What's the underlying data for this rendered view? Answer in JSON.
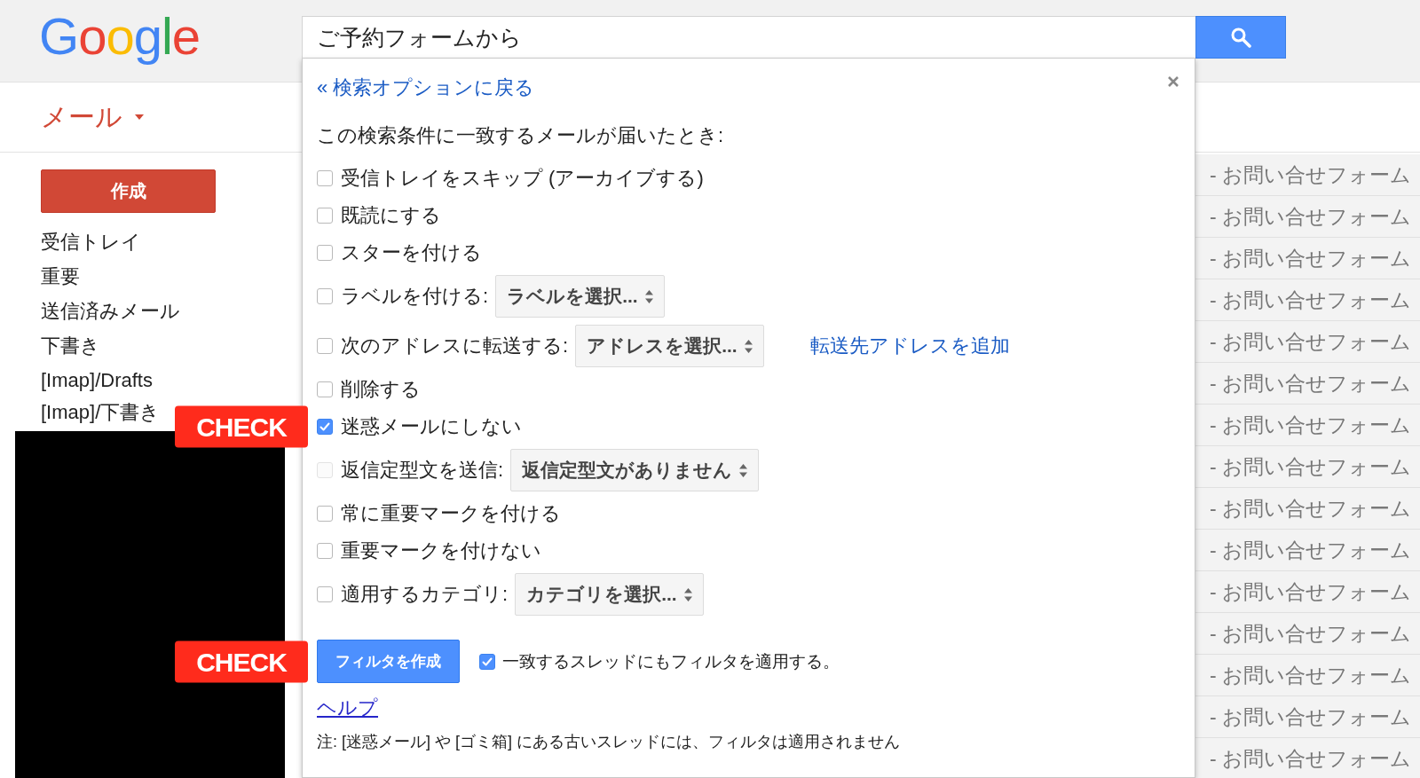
{
  "header": {
    "logo": "Google",
    "search": {
      "value": "ご予約フォームから"
    }
  },
  "app_menu": {
    "label": "メール"
  },
  "sidebar": {
    "compose_button": "作成",
    "items": [
      "受信トレイ",
      "重要",
      "送信済みメール",
      "下書き",
      "[Imap]/Drafts",
      "[Imap]/下書き"
    ]
  },
  "filter_dialog": {
    "back_link": "« 検索オプションに戻る",
    "heading": "この検索条件に一致するメールが届いたとき:",
    "options": [
      {
        "kind": "checkbox",
        "label": "受信トレイをスキップ (アーカイブする)",
        "checked": false,
        "disabled": false
      },
      {
        "kind": "checkbox",
        "label": "既読にする",
        "checked": false,
        "disabled": false
      },
      {
        "kind": "checkbox",
        "label": "スターを付ける",
        "checked": false,
        "disabled": false
      },
      {
        "kind": "select",
        "label": "ラベルを付ける:",
        "checked": false,
        "disabled": false,
        "select": "ラベルを選択..."
      },
      {
        "kind": "select",
        "label": "次のアドレスに転送する:",
        "checked": false,
        "disabled": false,
        "select": "アドレスを選択...",
        "link": "転送先アドレスを追加"
      },
      {
        "kind": "checkbox",
        "label": "削除する",
        "checked": false,
        "disabled": false
      },
      {
        "kind": "checkbox",
        "label": "迷惑メールにしない",
        "checked": true,
        "disabled": false,
        "annotation": "CHECK"
      },
      {
        "kind": "select",
        "label": "返信定型文を送信:",
        "checked": false,
        "disabled": true,
        "select": "返信定型文がありません"
      },
      {
        "kind": "checkbox",
        "label": "常に重要マークを付ける",
        "checked": false,
        "disabled": false
      },
      {
        "kind": "checkbox",
        "label": "重要マークを付けない",
        "checked": false,
        "disabled": false
      },
      {
        "kind": "select",
        "label": "適用するカテゴリ:",
        "checked": false,
        "disabled": false,
        "select": "カテゴリを選択..."
      }
    ],
    "create_filter": {
      "button": "フィルタを作成",
      "annotation": "CHECK"
    },
    "apply_to_threads": {
      "label": "一致するスレッドにもフィルタを適用する。",
      "checked": true
    },
    "help_link": "ヘルプ",
    "note": "注: [迷惑メール] や [ゴミ箱] にある古いスレッドには、フィルタは適用されません"
  },
  "mail_list": {
    "rows": [
      "- お問い合せフォーム",
      "- お問い合せフォーム",
      "- お問い合せフォーム",
      "- お問い合せフォーム",
      "- お問い合せフォーム",
      "- お問い合せフォーム",
      "- お問い合せフォーム",
      "- お問い合せフォーム",
      "- お問い合せフォーム",
      "- お問い合せフォーム",
      "- お問い合せフォーム",
      "- お問い合せフォーム",
      "- お問い合せフォーム",
      "- お問い合せフォーム",
      "- お問い合せフォーム"
    ]
  }
}
